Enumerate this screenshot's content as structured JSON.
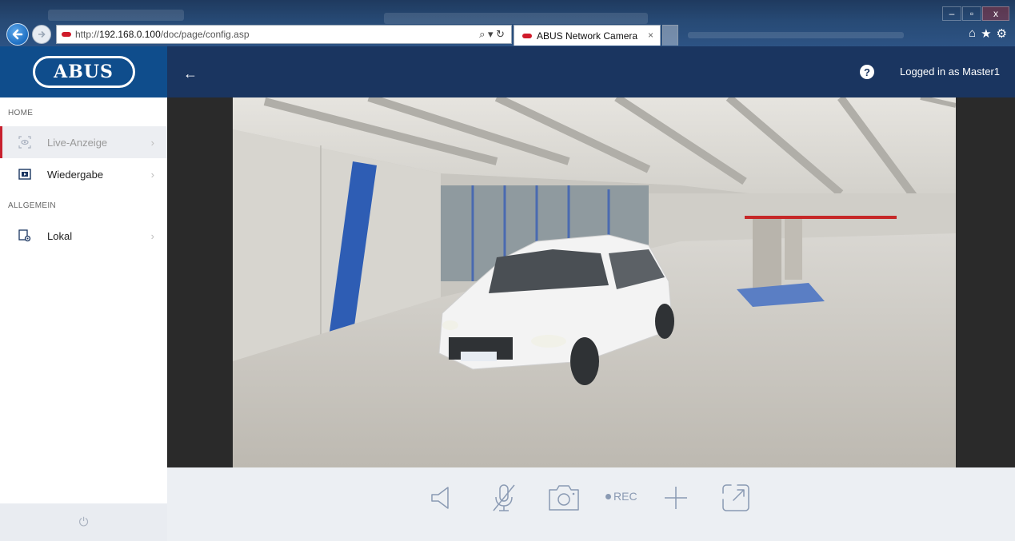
{
  "browser": {
    "url_prefix": "http://",
    "url_host": "192.168.0.100",
    "url_path": "/doc/page/config.asp",
    "addr_tools": "⌕ ▾ ↻",
    "tab_title": "ABUS Network Camera",
    "tab_close": "×",
    "win_min": "–",
    "win_max": "▫",
    "win_close": "x",
    "right_icons": [
      "⌂",
      "★",
      "⚙"
    ]
  },
  "header": {
    "logo_text": "ABUS",
    "back_glyph": "←",
    "help_glyph": "?",
    "login_text": "Logged in as Master1",
    "colors": {
      "logo_bg": "#0f4d8c",
      "bar_bg": "#1a3560",
      "accent": "#c8202e"
    }
  },
  "sidebar": {
    "sections": [
      {
        "label": "HOME"
      },
      {
        "label": "ALLGEMEIN"
      }
    ],
    "items": [
      {
        "label": "Live-Anzeige",
        "icon": "live-view-icon",
        "active": true,
        "chevron": "›"
      },
      {
        "label": "Wiedergabe",
        "icon": "playback-icon",
        "active": false,
        "chevron": "›"
      },
      {
        "label": "Lokal",
        "icon": "local-settings-icon",
        "active": false,
        "chevron": "›"
      }
    ],
    "power_glyph": "⏻"
  },
  "toolbar": {
    "rec_label": "REC",
    "tools": [
      "speaker-icon",
      "mic-muted-icon",
      "camera-snapshot-icon",
      "rec-indicator",
      "zoom-plus-icon",
      "fullscreen-icon"
    ]
  }
}
